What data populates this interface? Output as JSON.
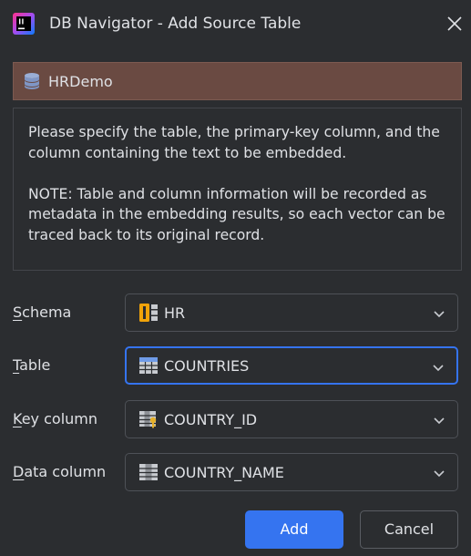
{
  "window": {
    "title": "DB Navigator - Add Source Table",
    "logo_icon": "intellij-logo-icon",
    "close_icon": "close-icon"
  },
  "connection": {
    "name": "HRDemo",
    "icon": "database-icon",
    "banner_color": "#6a4a42"
  },
  "info": {
    "paragraph1": "Please specify the table, the primary-key column, and the column containing the text to be embedded.",
    "paragraph2": "NOTE: Table and column information will be recorded as metadata in the embedding results, so each vector can be traced back to its original record."
  },
  "form": {
    "schema": {
      "mnemonic": "S",
      "label_rest": "chema",
      "value": "HR",
      "icon": "schema-icon"
    },
    "table": {
      "mnemonic": "T",
      "label_rest": "able",
      "value": "COUNTRIES",
      "icon": "table-icon"
    },
    "key_column": {
      "mnemonic": "K",
      "label_rest": "ey column",
      "value": "COUNTRY_ID",
      "icon": "primary-key-column-icon"
    },
    "data_column": {
      "mnemonic": "D",
      "label_rest": "ata column",
      "value": "COUNTRY_NAME",
      "icon": "column-icon"
    }
  },
  "buttons": {
    "add": "Add",
    "cancel": "Cancel"
  },
  "colors": {
    "accent": "#3574f0",
    "background": "#2b2d30"
  }
}
